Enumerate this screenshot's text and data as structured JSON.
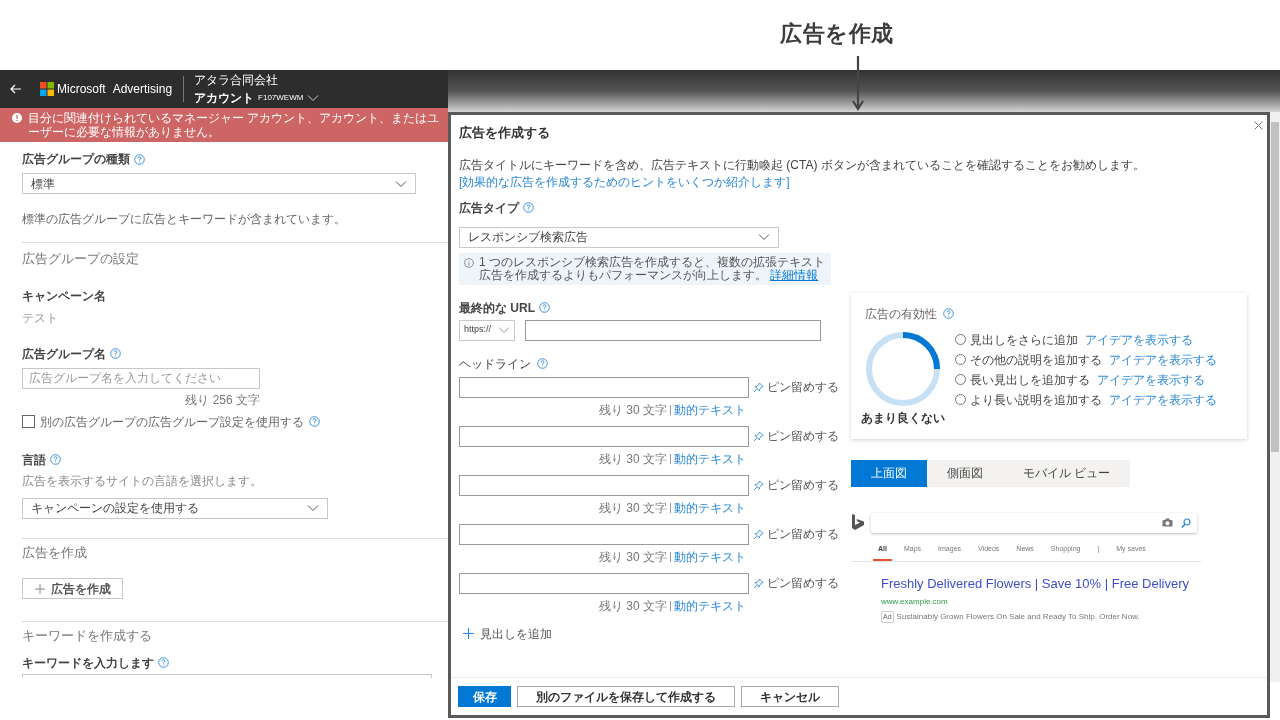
{
  "annotation": {
    "title": "広告を作成"
  },
  "header": {
    "brand_1": "Microsoft",
    "brand_2": "Advertising",
    "company": "アタラ合同会社",
    "account_label": "アカウント",
    "account_id": "F107WEWM"
  },
  "error_banner": {
    "message": "目分に関連付けられているマネージャー アカウント、アカウント、またはユーザーに必要な情報がありません。"
  },
  "ad_group_type": {
    "label": "広告グループの種類",
    "value": "標準",
    "note": "標準の広告グループに広告とキーワードが含まれています。"
  },
  "ad_group_settings": {
    "heading": "広告グループの設定",
    "campaign_name_label": "キャンペーン名",
    "campaign_name": "テスト",
    "ad_group_name_label": "広告グループ名",
    "ad_group_name_placeholder": "広告グループ名を入力してください",
    "remaining": "残り 256 文字",
    "use_other": {
      "label": "別の広告グループの広告グループ設定を使用する",
      "checked": false
    }
  },
  "language": {
    "label": "言語",
    "description": "広告を表示するサイトの言語を選択します。",
    "value": "キャンペーンの設定を使用する"
  },
  "create_ad": {
    "heading": "広告を作成",
    "button": "広告を作成"
  },
  "keywords": {
    "heading": "キーワードを作成する",
    "input_label": "キーワードを入力します"
  },
  "modal": {
    "title": "広告を作成する",
    "intro": "広告タイトルにキーワードを含め、広告テキストに行動喚起 (CTA) ボタンが含まれていることを確認することをお勧めします。",
    "intro_link": "[効果的な広告を作成するためのヒントをいくつか紹介します]",
    "ad_type": {
      "label": "広告タイプ",
      "value": "レスポンシブ検索広告",
      "info": "1 つのレスポンシブ検索広告を作成すると、複数の拡張テキスト広告を作成するよりもパフォーマンスが向上します。",
      "info_link": "詳細情報"
    },
    "final_url": {
      "label": "最終的な URL",
      "protocol": "https://"
    },
    "headlines_label": "ヘッドライン",
    "headlines": [
      {
        "pin": "ピン留めする",
        "remaining": "残り 30 文字",
        "dynamic_text": "動的テキスト"
      },
      {
        "pin": "ピン留めする",
        "remaining": "残り 30 文字",
        "dynamic_text": "動的テキスト"
      },
      {
        "pin": "ピン留めする",
        "remaining": "残り 30 文字",
        "dynamic_text": "動的テキスト"
      },
      {
        "pin": "ピン留めする",
        "remaining": "残り 30 文字",
        "dynamic_text": "動的テキスト"
      },
      {
        "pin": "ピン留めする",
        "remaining": "残り 30 文字",
        "dynamic_text": "動的テキスト"
      }
    ],
    "add_headline": "見出しを追加",
    "effectiveness": {
      "title": "広告の有効性",
      "level": 0.25,
      "rating": "あまり良くない",
      "suggestions": [
        {
          "text": "見出しをさらに追加",
          "link": "アイデアを表示する",
          "checked": false
        },
        {
          "text": "その他の説明を追加する",
          "link": "アイデアを表示する",
          "checked": false
        },
        {
          "text": "長い見出しを追加する",
          "link": "アイデアを表示する",
          "checked": false
        },
        {
          "text": "より長い説明を追加する",
          "link": "アイデアを表示する",
          "checked": false
        }
      ]
    },
    "preview_tabs": [
      {
        "label": "上面図",
        "selected": true
      },
      {
        "label": "側面図",
        "selected": false
      },
      {
        "label": "モバイル ビュー",
        "selected": false
      }
    ],
    "bing_preview": {
      "nav": [
        {
          "label": "All",
          "selected": true
        },
        {
          "label": "Maps",
          "selected": false
        },
        {
          "label": "Images",
          "selected": false
        },
        {
          "label": "Videos",
          "selected": false
        },
        {
          "label": "News",
          "selected": false
        },
        {
          "label": "Shopping",
          "selected": false
        },
        {
          "label": "|",
          "selected": false
        },
        {
          "label": "My saves",
          "selected": false
        }
      ],
      "ad_title": "Freshly Delivered Flowers | Save 10% | Free Delivery",
      "ad_url": "www.example.com",
      "ad_badge": "Ad",
      "ad_description": "Sustainably Grown Flowers On Sale and Ready To Ship. Order Now."
    },
    "buttons": [
      {
        "label": "保存",
        "kind": "primary"
      },
      {
        "label": "別のファイルを保存して作成する",
        "kind": "secondary"
      },
      {
        "label": "キャンセル",
        "kind": "secondary"
      }
    ]
  }
}
